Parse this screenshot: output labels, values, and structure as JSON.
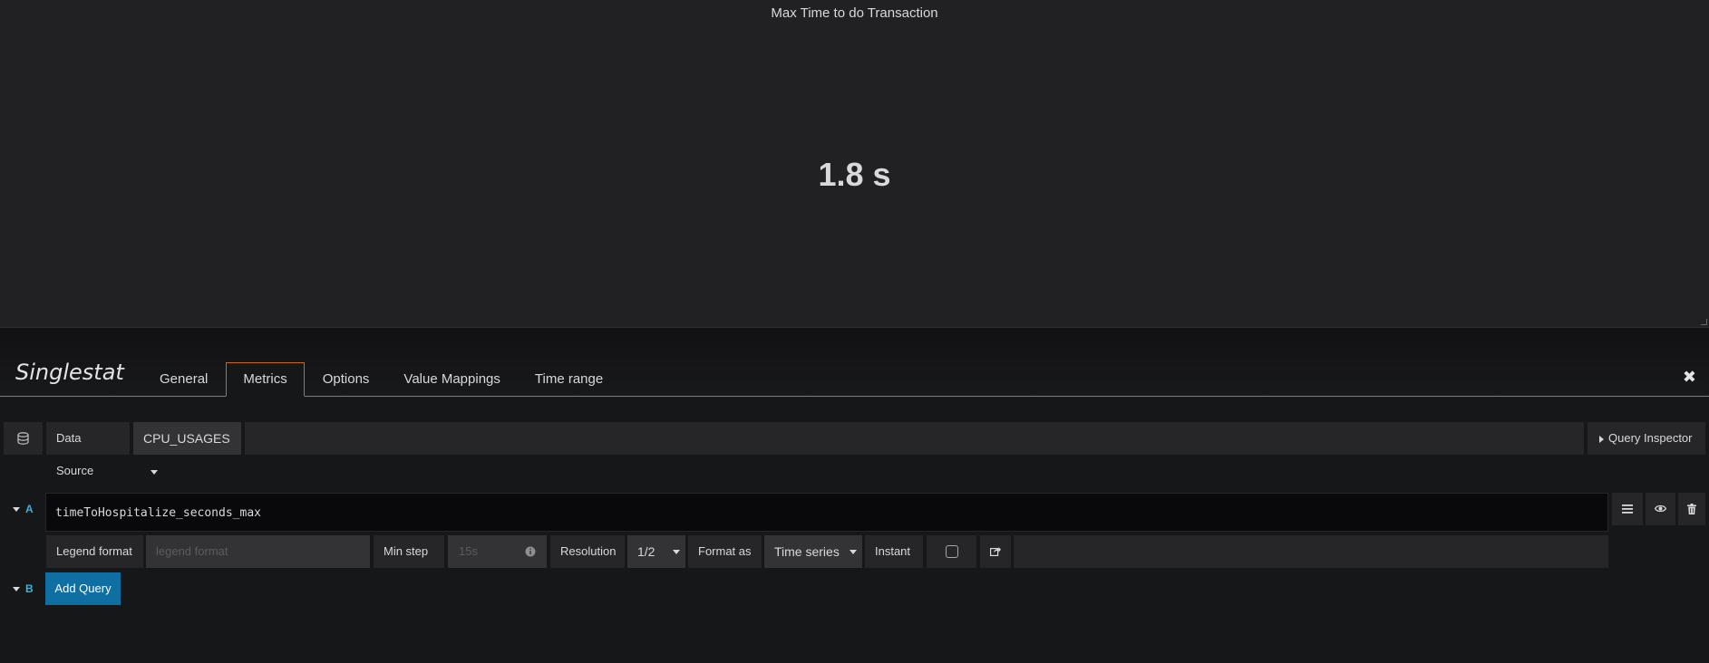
{
  "panel": {
    "title": "Max Time to do Transaction",
    "value": "1.8 s"
  },
  "editor": {
    "title": "Singlestat",
    "tabs": [
      {
        "label": "General",
        "active": false
      },
      {
        "label": "Metrics",
        "active": true
      },
      {
        "label": "Options",
        "active": false
      },
      {
        "label": "Value Mappings",
        "active": false
      },
      {
        "label": "Time range",
        "active": false
      }
    ],
    "accent_color": "#c96a17"
  },
  "datasource": {
    "label": "Data Source",
    "value": "CPU_USAGES",
    "query_inspector_label": "Query Inspector"
  },
  "queries": [
    {
      "letter": "A",
      "expression": "timeToHospitalize_seconds_max",
      "legend_format_label": "Legend format",
      "legend_format_placeholder": "legend format",
      "min_step_label": "Min step",
      "min_step_placeholder": "15s",
      "resolution_label": "Resolution",
      "resolution_value": "1/2",
      "format_as_label": "Format as",
      "format_as_value": "Time series",
      "instant_label": "Instant",
      "instant_checked": false
    },
    {
      "letter": "B",
      "add_query_label": "Add Query"
    }
  ],
  "icons": [
    "database-icon",
    "hamburger-icon",
    "eye-icon",
    "trash-icon",
    "info-icon",
    "share-icon",
    "close-icon"
  ]
}
